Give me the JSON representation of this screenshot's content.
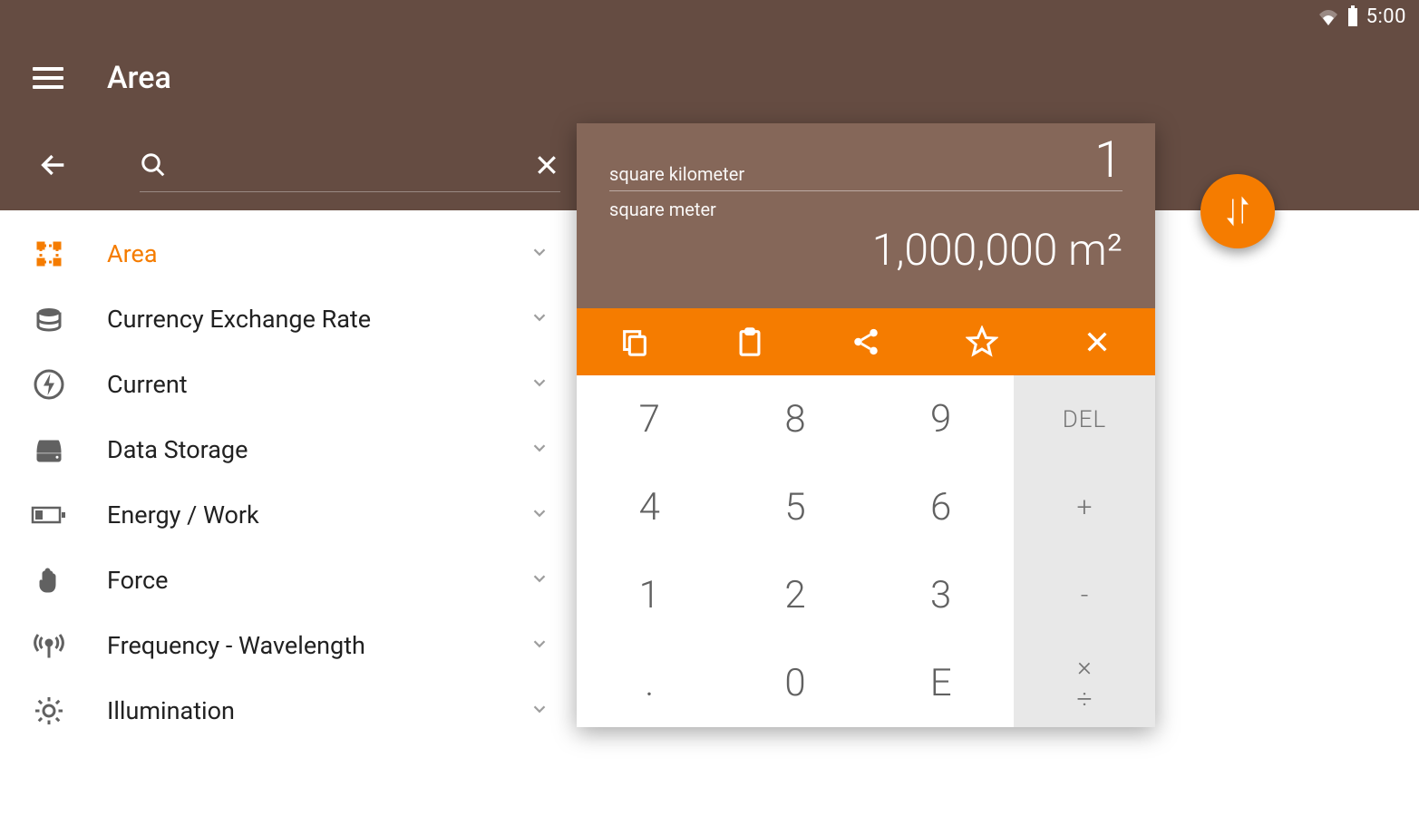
{
  "status": {
    "time": "5:00"
  },
  "appbar": {
    "title": "Area"
  },
  "search": {
    "placeholder": ""
  },
  "categories": [
    {
      "key": "area",
      "label": "Area",
      "active": true
    },
    {
      "key": "currency",
      "label": "Currency Exchange Rate",
      "active": false
    },
    {
      "key": "current",
      "label": "Current",
      "active": false
    },
    {
      "key": "data",
      "label": "Data Storage",
      "active": false
    },
    {
      "key": "energy",
      "label": "Energy / Work",
      "active": false
    },
    {
      "key": "force",
      "label": "Force",
      "active": false
    },
    {
      "key": "frequency",
      "label": "Frequency - Wavelength",
      "active": false
    },
    {
      "key": "illumination",
      "label": "Illumination",
      "active": false
    }
  ],
  "converter": {
    "from_unit": "square kilometer",
    "from_value": "1",
    "to_unit": "square meter",
    "to_value": "1,000,000 m²"
  },
  "keypad": {
    "k7": "7",
    "k8": "8",
    "k9": "9",
    "del": "DEL",
    "k4": "4",
    "k5": "5",
    "k6": "6",
    "plus": "+",
    "k1": "1",
    "k2": "2",
    "k3": "3",
    "minus": "-",
    "dot": ".",
    "k0": "0",
    "ke": "E",
    "mult": "×",
    "div": "÷"
  }
}
